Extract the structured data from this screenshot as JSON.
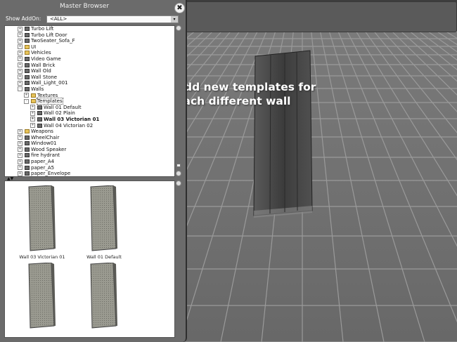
{
  "window": {
    "title": "Master Browser",
    "close_glyph": "✖"
  },
  "filter": {
    "label": "Show AddOn:",
    "value": "<ALL>",
    "dropdown_icon": "chevron-down-icon"
  },
  "tree_items": [
    {
      "label": "Turbo Lift",
      "icon": "cube",
      "depth": 0,
      "expander": "+"
    },
    {
      "label": "Turbo Lift Door",
      "icon": "cube",
      "depth": 0,
      "expander": "+"
    },
    {
      "label": "TwoSeater_Sofa_F",
      "icon": "cube",
      "depth": 0,
      "expander": "+"
    },
    {
      "label": "UI",
      "icon": "folder",
      "depth": 0,
      "expander": "+"
    },
    {
      "label": "Vehicles",
      "icon": "folder",
      "depth": 0,
      "expander": "+"
    },
    {
      "label": "Video Game",
      "icon": "cube",
      "depth": 0,
      "expander": "+"
    },
    {
      "label": "Wall Brick",
      "icon": "cube",
      "depth": 0,
      "expander": "+"
    },
    {
      "label": "Wall Old",
      "icon": "cube",
      "depth": 0,
      "expander": "+"
    },
    {
      "label": "Wall Stone",
      "icon": "cube",
      "depth": 0,
      "expander": "+"
    },
    {
      "label": "Wall_Light_001",
      "icon": "cube",
      "depth": 0,
      "expander": "+"
    },
    {
      "label": "Walls",
      "icon": "cube",
      "depth": 0,
      "expander": "-"
    },
    {
      "label": "Textures",
      "icon": "folder",
      "depth": 1,
      "expander": "+"
    },
    {
      "label": "Templates",
      "icon": "folder",
      "depth": 1,
      "expander": "-",
      "selected": true
    },
    {
      "label": "Wall 01 Default",
      "icon": "cube",
      "depth": 2,
      "expander": "+"
    },
    {
      "label": "Wall 02 Plain",
      "icon": "cube",
      "depth": 2,
      "expander": "+"
    },
    {
      "label": "Wall 03 Victorian 01",
      "icon": "cube",
      "depth": 2,
      "expander": "+",
      "bold": true
    },
    {
      "label": "Wall 04 Victorian 02",
      "icon": "cube",
      "depth": 2,
      "expander": "+"
    },
    {
      "label": "Weapons",
      "icon": "folder",
      "depth": 0,
      "expander": "+"
    },
    {
      "label": "WheelChair",
      "icon": "cube",
      "depth": 0,
      "expander": "+"
    },
    {
      "label": "Window01",
      "icon": "cube",
      "depth": 0,
      "expander": "+"
    },
    {
      "label": "Wood Speaker",
      "icon": "cube",
      "depth": 0,
      "expander": "+"
    },
    {
      "label": "fire hydrant",
      "icon": "cube",
      "depth": 0,
      "expander": "+"
    },
    {
      "label": "paper_A4",
      "icon": "cube",
      "depth": 0,
      "expander": "+"
    },
    {
      "label": "paper_A5",
      "icon": "cube",
      "depth": 0,
      "expander": "+"
    },
    {
      "label": "paper_Envelope",
      "icon": "cube",
      "depth": 0,
      "expander": "+"
    }
  ],
  "splitter_glyph": "▲▼",
  "thumbnails": [
    {
      "label": "Wall 03 Victorian 01"
    },
    {
      "label": "Wall 01 Default"
    },
    {
      "label": ""
    },
    {
      "label": ""
    }
  ],
  "annotation": {
    "line1": "Add new templates for",
    "line2": "each different wall"
  },
  "colors": {
    "arrow": "#8fd63a",
    "panel": "#6b6b6b",
    "floor": "#6f6f6f",
    "sky": "#3e3e3e"
  }
}
